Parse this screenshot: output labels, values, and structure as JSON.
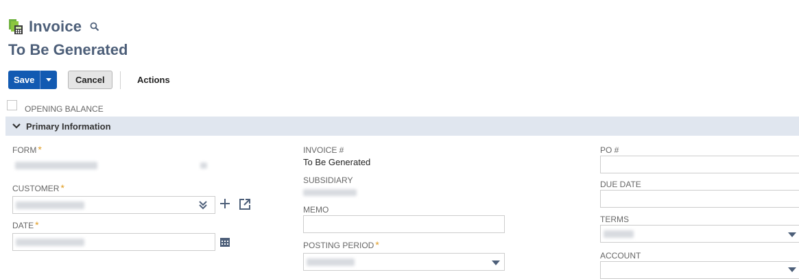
{
  "header": {
    "title": "Invoice",
    "subtitle": "To Be Generated",
    "icon": "invoice-icon",
    "search_icon": "search-icon"
  },
  "toolbar": {
    "save_label": "Save",
    "cancel_label": "Cancel",
    "actions_label": "Actions"
  },
  "opening_balance": {
    "label": "OPENING BALANCE",
    "checked": false
  },
  "section": {
    "label": "Primary Information",
    "expanded": true
  },
  "fields": {
    "form": {
      "label": "FORM",
      "required": "*"
    },
    "customer": {
      "label": "CUSTOMER",
      "required": "*"
    },
    "date": {
      "label": "DATE",
      "required": "*"
    },
    "invoice_no": {
      "label": "INVOICE #",
      "value": "To Be Generated"
    },
    "subsidiary": {
      "label": "SUBSIDIARY"
    },
    "memo": {
      "label": "MEMO"
    },
    "posting_period": {
      "label": "POSTING PERIOD",
      "required": "*"
    },
    "po": {
      "label": "PO #"
    },
    "due_date": {
      "label": "DUE DATE"
    },
    "terms": {
      "label": "TERMS"
    },
    "account": {
      "label": "ACCOUNT"
    }
  },
  "colors": {
    "primary_button": "#125ab2",
    "title": "#4d5f79",
    "section_bar": "#e0e6ef",
    "required": "#e09b1f"
  }
}
